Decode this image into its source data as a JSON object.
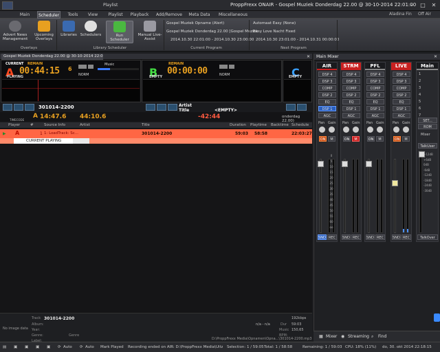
{
  "window": {
    "context_tab": "Playlist",
    "title": "ProppFrexx ONAIR - Gospel Muziek Donderdag 22.00 @ 30-10-2014 22:01:00"
  },
  "menu": {
    "tabs": [
      "Main",
      "Scheduler",
      "Tools",
      "View",
      "Playlist",
      "Playback",
      "Add/Remove",
      "Meta Data",
      "Miscellaneous"
    ],
    "active": "Scheduler",
    "user": "Aladina Fin",
    "status": "Off Air"
  },
  "ribbon": {
    "advert": "Advert News Management",
    "upcoming": "Upcoming Overlays",
    "libraries": "Libraries",
    "schedulers": "Schedulers",
    "run_scheduler": "Run Scheduler",
    "manual": "Manual Live-Assist",
    "group_overlays": "Overlays",
    "group_library": "Library Scheduler",
    "current_program_lines": [
      "Gospel Muziek Opname (Alert)",
      "Gospel Muziek Donderdag 22.00 [Gospel Muziek",
      "2014.10.30 22:01:00 - 2014.10.30 23:00:00"
    ],
    "group_current": "Current Program",
    "next_program_lines": [
      "Automaat Easy (None)",
      "Easy Love Nacht Fixed",
      "2014.10.30 23:01:00 - 2014.10.31 00:00:00"
    ],
    "group_next": "Next Program"
  },
  "playlist": {
    "tab_title": "Gospel Muziek Donderdag 22.00 @ 30-10-2014 22:01:00",
    "deck_a": {
      "letter": "A",
      "state_top": "CURRENT",
      "state": "PLAYING",
      "remain": "REMAIN",
      "time": "00:44:15",
      "time_frac": "6",
      "mode": "NORM",
      "cat": "Music"
    },
    "deck_b": {
      "letter": "B",
      "state": "EMPTY",
      "remain": "REMAIN",
      "time": "00:00:00",
      "mode": "NORM"
    },
    "deck_c": {
      "letter": "C",
      "state": "EMPTY"
    },
    "current_track": "301014-2200",
    "artist_label": "Artist",
    "title_label": "Title",
    "next_title": "<EMPTY>",
    "timecode_label": "TIMECODE",
    "time_a_label": "A",
    "time_a": "14:47.6",
    "time_b": "44:10.6",
    "time_c": "-42:44",
    "right_note": "onderdag 22.00)"
  },
  "table": {
    "headers": [
      "Player",
      "#",
      "Source Info",
      "Artist",
      "Title",
      "Duration",
      "Playtime",
      "Backtime",
      "Schedule"
    ],
    "row": {
      "player": "A",
      "num": "1",
      "source": "1: LoadTrack: Sc...",
      "title": "301014-2200",
      "duration": "59:03",
      "playtime": "58:58",
      "schedule": "22:03:27",
      "status": "CURRENT   PLAYING"
    }
  },
  "info": {
    "no_image": "No image data",
    "track_label": "Track",
    "track": "301014-2200",
    "labels": [
      "Album:",
      "Year:",
      "Genre:",
      "Label:"
    ],
    "genre_label": "Genre",
    "bitrate": "192kbps",
    "na": "n/a - n/a",
    "dur_label": "Dur",
    "dur": "59:03",
    "music_label": "Music",
    "bpm": "BPM:",
    "bpm_val": "150,65",
    "path": "D:\\ProppFrexx Media\\Opnamen\\Opna...\\301014-2200.mp3"
  },
  "mixer": {
    "title": "Main Mixer",
    "strips": [
      {
        "name": "AIR",
        "color": "#c82020",
        "on_label": "ON",
        "m_label": "M",
        "bot1": "SND",
        "bot2": "REC"
      },
      {
        "name": "STRM",
        "color": "#c82020",
        "on_label": "ON",
        "m_label": "M",
        "bot1": "SND",
        "bot2": "REC"
      },
      {
        "name": "PFL",
        "color": "#3a3b41",
        "on_label": "ON",
        "m_label": "M",
        "bot1": "SND",
        "bot2": "REC"
      },
      {
        "name": "LIVE",
        "color": "#c82020",
        "on_label": "ON",
        "m_label": "M",
        "bot1": "SND",
        "bot2": "REC"
      }
    ],
    "rows": [
      "DSP 4",
      "DSP 3",
      "COMP",
      "DSP 2",
      "EQ",
      "DSP 1",
      "AGC"
    ],
    "pan": "Pan",
    "gain": "Gain",
    "scale": [
      "0",
      "5",
      "10",
      "15",
      "20",
      "25",
      "30",
      "35",
      "40",
      "45",
      "50",
      "55",
      "60",
      "oo"
    ],
    "main": {
      "name": "Main",
      "items": [
        "1",
        "2",
        "3",
        "4",
        "5",
        "6",
        "7",
        "SET...",
        "ROM"
      ],
      "mixer": "Mixer",
      "talkuser": "TalkUser",
      "talkover": "TalkOver"
    },
    "db": [
      "+12dB",
      "+6dB",
      "0dB",
      "-6dB",
      "-12dB",
      "-18dB",
      "-24dB",
      "-30dB"
    ]
  },
  "mixer_tabs": [
    "Mixer",
    "Streaming",
    "Find"
  ],
  "statusbar": {
    "auto1": "Auto",
    "auto2": "Auto",
    "mark": "Mark Played",
    "rec": "Recording ended on AIR: D:\\ProppFrexx Media\\Uitzend...",
    "selection": "Selection: 1 / 59:05",
    "total": "Total: 1 / 58:58",
    "remaining": "Remaining: 1 / 59:03",
    "cpu": "CPU: 18% (11%)",
    "datetime": "do, 30. okt 2014 22:18:15"
  },
  "colors": {
    "accent": "#e8a020",
    "deck_a": "#ff4a20",
    "deck_b": "#44dd44",
    "deck_c": "#3aa0ff",
    "row": "#ff6644"
  }
}
